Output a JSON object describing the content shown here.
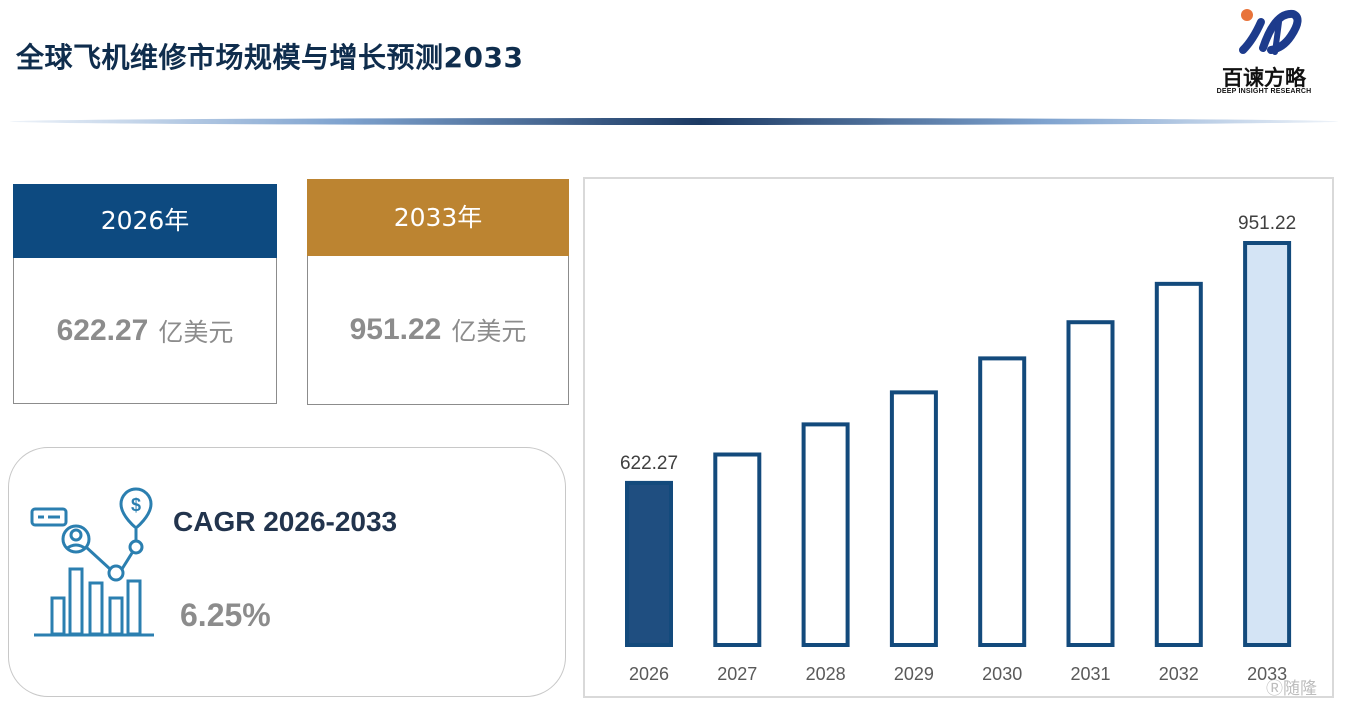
{
  "header": {
    "title": "全球飞机维修市场规模与增长预测2033",
    "logo_text": "百谏方略",
    "logo_sub": "DEEP INSIGHT RESEARCH"
  },
  "cards": [
    {
      "year_label": "2026年",
      "value": "622.27",
      "unit": "亿美元",
      "color": "#0d4a80"
    },
    {
      "year_label": "2033年",
      "value": "951.22",
      "unit": "亿美元",
      "color": "#bc8431"
    }
  ],
  "cagr": {
    "label": "CAGR 2026-2033",
    "value": "6.25%"
  },
  "watermark": "随隆",
  "chart_data": {
    "type": "bar",
    "categories": [
      "2026",
      "2027",
      "2028",
      "2029",
      "2030",
      "2031",
      "2032",
      "2033"
    ],
    "values": [
      622.27,
      661.2,
      702.5,
      746.4,
      793.0,
      842.6,
      895.2,
      951.22
    ],
    "data_labels": {
      "2026": "622.27",
      "2033": "951.22"
    },
    "title": "",
    "xlabel": "",
    "ylabel": "",
    "ylim": [
      0,
      1000
    ],
    "grid": false,
    "legend": "none",
    "colors": {
      "outline": "#134a7c",
      "first_fill": "#1f4e80",
      "last_fill": "#d4e4f5",
      "middle_fill": "#ffffff",
      "label": "#404040"
    }
  }
}
